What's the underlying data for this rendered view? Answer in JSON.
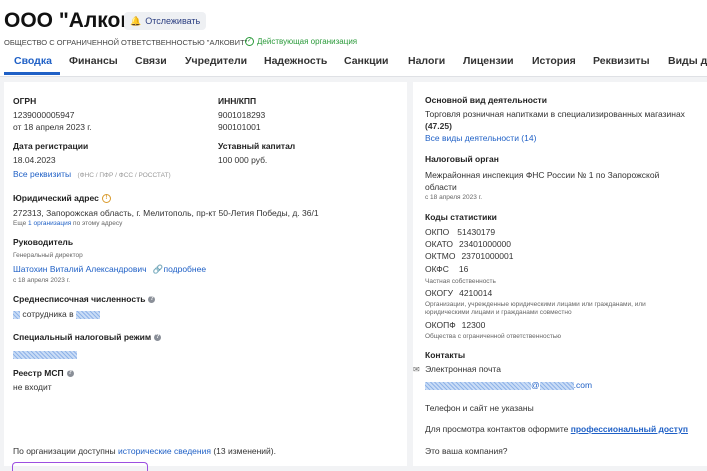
{
  "company": {
    "name": "ООО \"Алковит\"",
    "follow_label": "Отслеживать",
    "full_name": "ОБЩЕСТВО С ОГРАНИЧЕННОЙ ОТВЕТСТВЕННОСТЬЮ \"АЛКОВИТ\"",
    "status": "Действующая организация"
  },
  "tabs": [
    "Сводка",
    "Финансы",
    "Связи",
    "Учредители",
    "Надежность",
    "Санкции",
    "Налоги",
    "Лицензии",
    "История",
    "Реквизиты",
    "Виды де"
  ],
  "left": {
    "ogrn_label": "ОГРН",
    "ogrn_value": "1239000005947",
    "ogrn_date": "от 18 апреля 2023 г.",
    "inn_label": "ИНН/КПП",
    "inn_value": "9001018293",
    "kpp_value": "900101001",
    "reg_label": "Дата регистрации",
    "reg_value": "18.04.2023",
    "capital_label": "Уставный капитал",
    "capital_value": "100 000 руб.",
    "all_requisites": "Все реквизиты",
    "requisites_note": "(ФНС / ПФР / ФСС / РОССТАТ)",
    "address_label": "Юридический адрес",
    "address_value": "272313, Запорожская область, г. Мелитополь, пр-кт 50-Летия Победы, д. 36/1",
    "address_note_pre": "Еще",
    "address_note_link": "1 организация",
    "address_note_post": "по этому адресу",
    "head_label": "Руководитель",
    "head_role": "Генеральный директор",
    "head_name": "Шатохин Виталий Александрович",
    "head_more": "подробнее",
    "head_date": "с 18 апреля 2023 г.",
    "employees_label": "Среднесписочная численность",
    "employees_value": "сотрудника в",
    "tax_regime_label": "Специальный налоговый режим",
    "msp_label": "Реестр МСП",
    "msp_value": "не входит",
    "history_pre": "По организации доступны",
    "history_link": "исторические сведения",
    "history_post": "(13 изменений)."
  },
  "right": {
    "activity_label": "Основной вид деятельности",
    "activity_value_1": "Торговля розничная напитками в специализированных магазинах",
    "activity_code": "(47.25)",
    "activity_all": "Все виды деятельности (14)",
    "tax_label": "Налоговый орган",
    "tax_value_1": "Межрайонная инспекция ФНС России № 1 по Запорожской",
    "tax_value_2": "области",
    "tax_date": "с 18 апреля 2023 г.",
    "stats_label": "Коды статистики",
    "okpo": "ОКПО",
    "okpo_v": "51430179",
    "okato": "ОКАТО",
    "okato_v": "23401000000",
    "oktmo": "ОКТМО",
    "oktmo_v": "23701000001",
    "okfs": "ОКФС",
    "okfs_v": "16",
    "okfs_note": "Частная собственность",
    "okogu": "ОКОГУ",
    "okogu_v": "4210014",
    "okogu_note_1": "Организации, учрежденные юридическими лицами или гражданами, или",
    "okogu_note_2": "юридическими лицами и гражданами совместно",
    "okopf": "ОКОПФ",
    "okopf_v": "12300",
    "okopf_note": "Общества с ограниченной ответственностью",
    "contacts_label": "Контакты",
    "email_label": "Электронная почта",
    "email_suffix": "@",
    "email_domain": ".com",
    "phone_note": "Телефон и сайт не указаны",
    "pro_pre": "Для просмотра контактов оформите",
    "pro_link": "профессиональный доступ",
    "your_company": "Это ваша компания?"
  }
}
